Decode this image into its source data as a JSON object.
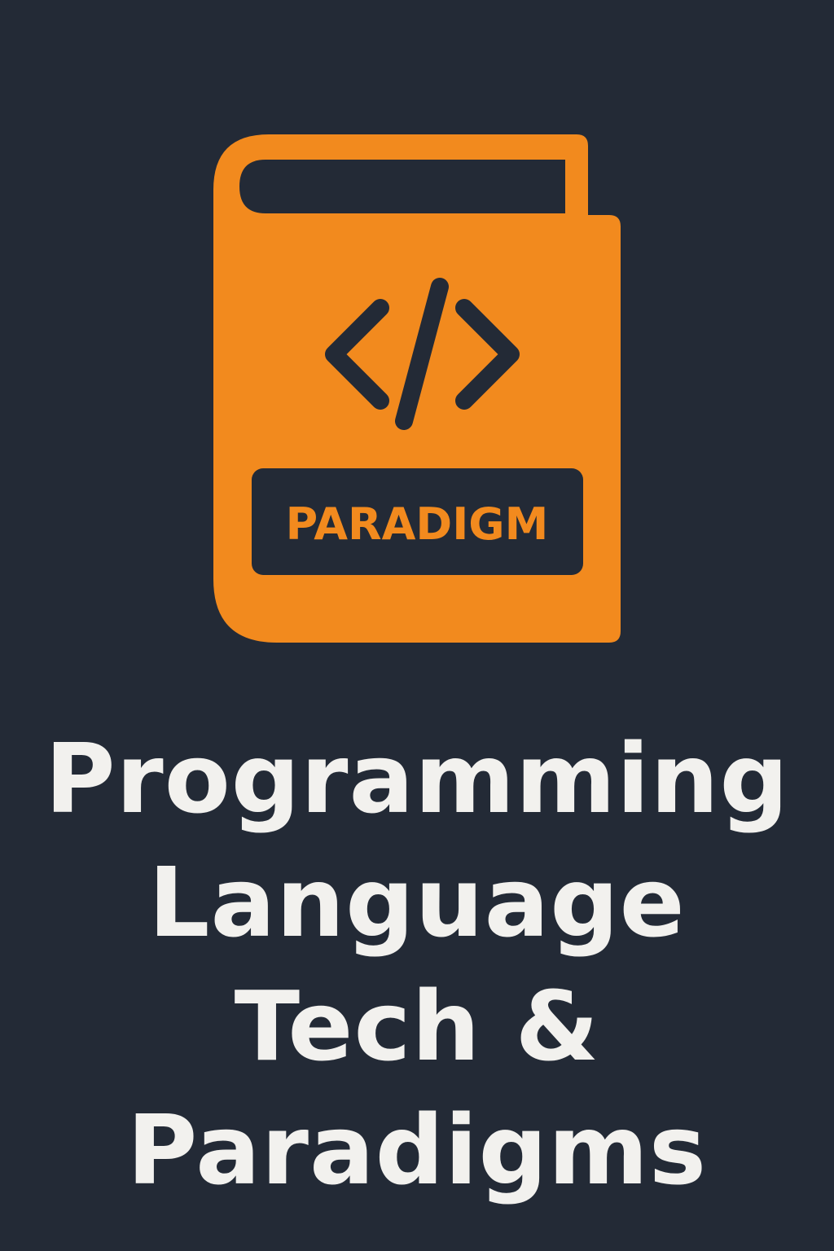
{
  "logo": {
    "icon": "code-book-icon",
    "symbol": "code-brackets-icon",
    "badge_label": "PARADIGM",
    "accent_color": "#f28a1e",
    "background_color": "#232a36"
  },
  "title": {
    "lines": [
      "Programming",
      "Language",
      "Tech &",
      "Paradigms"
    ],
    "color": "#f2f1ee"
  }
}
